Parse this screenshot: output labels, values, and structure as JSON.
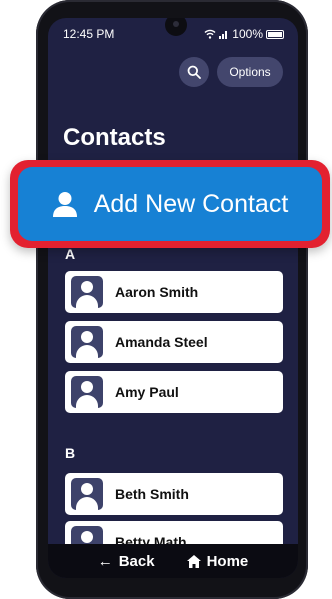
{
  "status": {
    "time": "12:45 PM",
    "battery": "100%"
  },
  "header": {
    "options_label": "Options"
  },
  "title": "Contacts",
  "add_button": {
    "label": "Add New Contact"
  },
  "sections": [
    {
      "letter": "A",
      "contacts": [
        "Aaron Smith",
        "Amanda Steel",
        "Amy Paul"
      ]
    },
    {
      "letter": "B",
      "contacts": [
        "Beth Smith",
        "Betty Math"
      ]
    }
  ],
  "bottom_nav": {
    "back_label": "Back",
    "home_label": "Home"
  },
  "colors": {
    "screen_bg": "#1f2143",
    "accent": "#1781d4",
    "highlight": "#e32130"
  }
}
